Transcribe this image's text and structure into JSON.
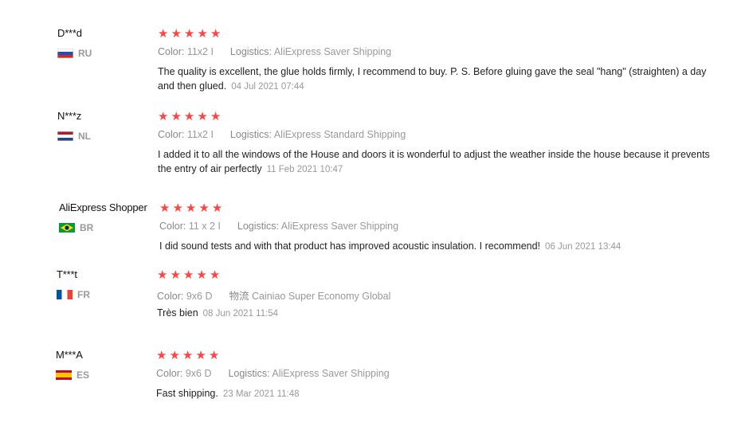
{
  "reviews": [
    {
      "user": "D***d",
      "country": "RU",
      "flag_colors": [
        "#ffffff",
        "#1f4fbf",
        "#d52b1e"
      ],
      "rating": 5,
      "color_label": "Color:",
      "color_value": "11x2 I",
      "logistics_label": "Logistics:",
      "logistics_value": "AliExpress Saver Shipping",
      "text": "The quality is excellent, the glue holds firmly, I recommend to buy. P. S. Before gluing gave the seal \"hang\" (straighten) a day and then glued.",
      "date": "04 Jul 2021 07:44"
    },
    {
      "user": "N***z",
      "country": "NL",
      "flag_colors": [
        "#ae1c28",
        "#ffffff",
        "#21468b"
      ],
      "rating": 5,
      "color_label": "Color:",
      "color_value": "11x2 I",
      "logistics_label": "Logistics:",
      "logistics_value": "AliExpress Standard Shipping",
      "text": "I added it to all the windows of the House and doors it is wonderful to adjust the weather inside the house because it prevents the entry of air perfectly",
      "date": "11 Feb 2021 10:47"
    },
    {
      "user": "AliExpress Shopper",
      "country": "BR",
      "flag_colors": [
        "#009c3b",
        "#ffdf00",
        "#002776"
      ],
      "rating": 5,
      "color_label": "Color:",
      "color_value": "11 x 2 I",
      "logistics_label": "Logistics:",
      "logistics_value": "AliExpress Saver Shipping",
      "text": "I did sound tests and with that product has improved acoustic insulation. I recommend!",
      "date": "06 Jun 2021 13:44"
    },
    {
      "user": "T***t",
      "country": "FR",
      "flag_colors": [
        "#0055a4",
        "#ffffff",
        "#ef4135"
      ],
      "rating": 5,
      "color_label": "Color:",
      "color_value": "9x6 D",
      "logistics_label": "物流",
      "logistics_value": "Cainiao Super Economy Global",
      "text": "Très bien",
      "date": "08 Jun 2021 11:54"
    },
    {
      "user": "M***A",
      "country": "ES",
      "flag_colors": [
        "#c60b1e",
        "#ffc400",
        "#c60b1e"
      ],
      "rating": 5,
      "color_label": "Color:",
      "color_value": "9x6 D",
      "logistics_label": "Logistics:",
      "logistics_value": "AliExpress Saver Shipping",
      "text": "Fast shipping.",
      "date": "23 Mar 2021 11:48"
    }
  ]
}
